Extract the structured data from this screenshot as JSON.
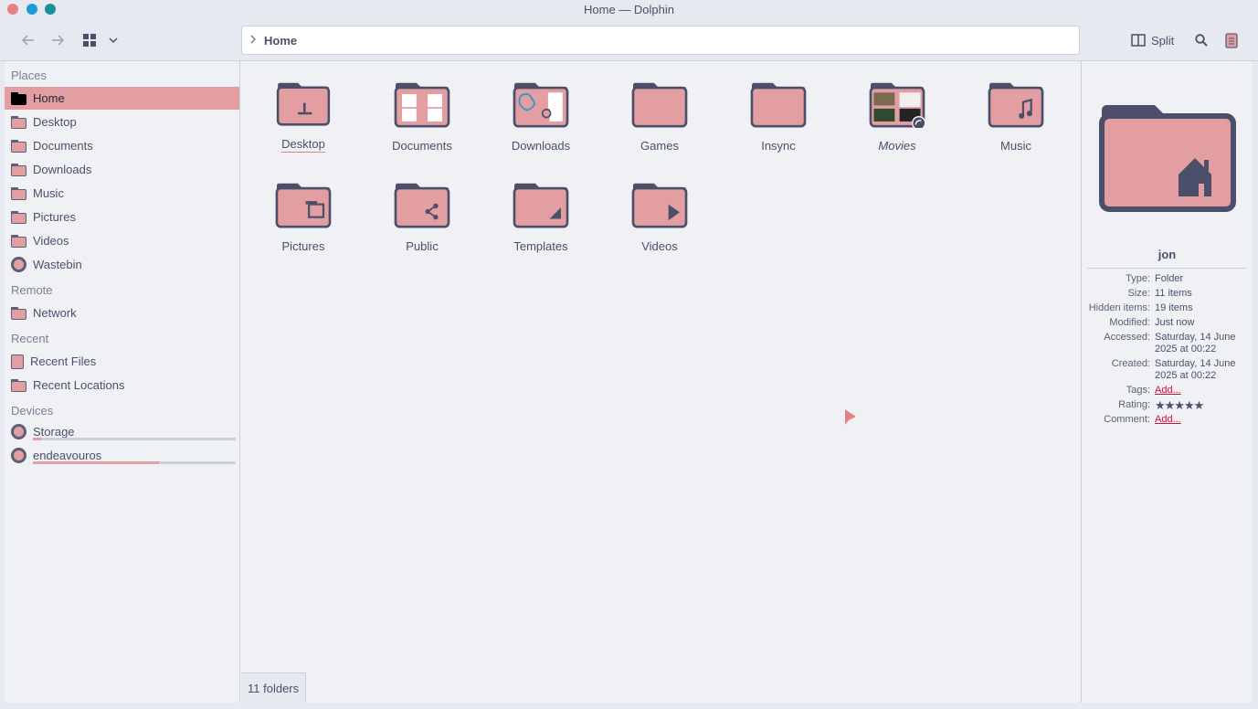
{
  "window": {
    "title": "Home — Dolphin"
  },
  "toolbar": {
    "address_crumb": "Home",
    "split_label": "Split"
  },
  "sidebar": {
    "sections": {
      "places": "Places",
      "remote": "Remote",
      "recent": "Recent",
      "devices": "Devices"
    },
    "places": [
      "Home",
      "Desktop",
      "Documents",
      "Downloads",
      "Music",
      "Pictures",
      "Videos",
      "Wastebin"
    ],
    "remote": [
      "Network"
    ],
    "recent": [
      "Recent Files",
      "Recent Locations"
    ],
    "devices": [
      {
        "label": "Storage",
        "usage": 0.04
      },
      {
        "label": "endeavouros",
        "usage": 0.62
      }
    ]
  },
  "folders": [
    "Desktop",
    "Documents",
    "Downloads",
    "Games",
    "Insync",
    "Movies",
    "Music",
    "Pictures",
    "Public",
    "Templates",
    "Videos"
  ],
  "status": {
    "text": "11 folders"
  },
  "info": {
    "name": "jon",
    "rows": [
      {
        "k": "Type:",
        "v": "Folder"
      },
      {
        "k": "Size:",
        "v": "11 items"
      },
      {
        "k": "Hidden items:",
        "v": "19 items"
      },
      {
        "k": "Modified:",
        "v": "Just now"
      },
      {
        "k": "Accessed:",
        "v": "Saturday, 14 June 2025 at 00:22"
      },
      {
        "k": "Created:",
        "v": "Saturday, 14 June 2025 at 00:22"
      },
      {
        "k": "Tags:",
        "v": "Add..."
      },
      {
        "k": "Rating:",
        "v": ""
      },
      {
        "k": "Comment:",
        "v": "Add..."
      }
    ],
    "rating": 0
  },
  "colors": {
    "accent": "#e39ea1",
    "dark": "#4c4f69",
    "link": "#d20f39"
  }
}
